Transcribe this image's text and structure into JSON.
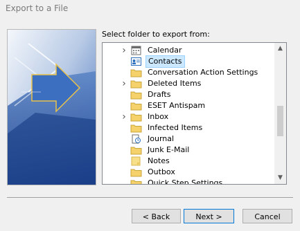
{
  "window": {
    "title": "Export to a File"
  },
  "prompt": "Select folder to export from:",
  "folders": [
    {
      "label": "Calendar",
      "icon": "calendar-icon",
      "expandable": true
    },
    {
      "label": "Contacts",
      "icon": "contacts-icon",
      "expandable": false,
      "selected": true
    },
    {
      "label": "Conversation Action Settings",
      "icon": "folder-icon",
      "expandable": false
    },
    {
      "label": "Deleted Items",
      "icon": "folder-icon",
      "expandable": true
    },
    {
      "label": "Drafts",
      "icon": "folder-icon",
      "expandable": false
    },
    {
      "label": "ESET Antispam",
      "icon": "folder-icon",
      "expandable": false
    },
    {
      "label": "Inbox",
      "icon": "folder-icon",
      "expandable": true
    },
    {
      "label": "Infected Items",
      "icon": "folder-icon",
      "expandable": false
    },
    {
      "label": "Journal",
      "icon": "journal-icon",
      "expandable": false
    },
    {
      "label": "Junk E-Mail",
      "icon": "folder-icon",
      "expandable": false
    },
    {
      "label": "Notes",
      "icon": "notes-icon",
      "expandable": false
    },
    {
      "label": "Outbox",
      "icon": "folder-icon",
      "expandable": false
    },
    {
      "label": "Quick Step Settings",
      "icon": "folder-icon",
      "expandable": false
    }
  ],
  "buttons": {
    "back": "< Back",
    "next": "Next >",
    "cancel": "Cancel"
  },
  "colors": {
    "selection": "#cce8ff",
    "folder": "#f5d16c",
    "accent": "#0078d7"
  }
}
